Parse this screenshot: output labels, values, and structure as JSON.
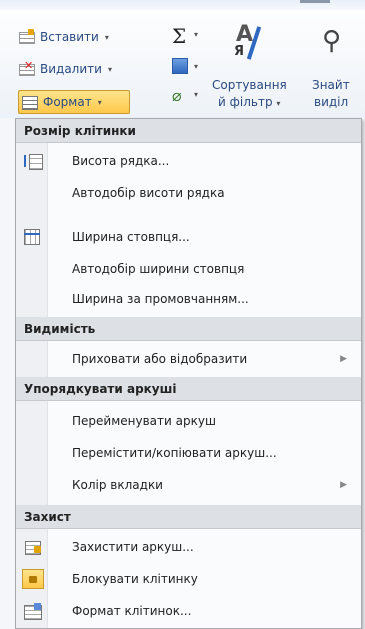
{
  "ribbon": {
    "cells": {
      "insert_label": "Вставити",
      "delete_label": "Видалити",
      "format_label": "Формат"
    },
    "editing": {
      "autosum_symbol": "Σ",
      "sort_line1": "Сортування",
      "sort_line2": "й фільтр",
      "find_line1": "Знайт",
      "find_line2": "виділ"
    }
  },
  "menu": {
    "sections": [
      {
        "header": "Розмір клітинки",
        "items": [
          {
            "label": "Висота рядка...",
            "icon": "row-height-icon"
          },
          {
            "label": "Автодобір висоти рядка",
            "icon": null
          },
          {
            "label": "Ширина стовпця...",
            "icon": "column-width-icon"
          },
          {
            "label": "Автодобір ширини стовпця",
            "icon": null
          },
          {
            "label": "Ширина за промовчанням...",
            "icon": null
          }
        ]
      },
      {
        "header": "Видимість",
        "items": [
          {
            "label": "Приховати або відобразити",
            "icon": null,
            "has_submenu": true
          }
        ]
      },
      {
        "header": "Упорядкувати аркуші",
        "items": [
          {
            "label": "Перейменувати аркуш",
            "icon": null
          },
          {
            "label": "Перемістити/копіювати аркуш...",
            "icon": null
          },
          {
            "label": "Колір вкладки",
            "icon": null,
            "has_submenu": true
          }
        ]
      },
      {
        "header": "Захист",
        "items": [
          {
            "label": "Захистити аркуш...",
            "icon": "protect-sheet-icon"
          },
          {
            "label": "Блокувати клітинку",
            "icon": "lock-icon"
          },
          {
            "label": "Формат клітинок...",
            "icon": "format-cells-icon"
          }
        ]
      }
    ]
  },
  "colors": {
    "accent_blue": "#2f68c0",
    "highlight_gold": "#ffc84a",
    "section_bg": "#dde0e4"
  }
}
